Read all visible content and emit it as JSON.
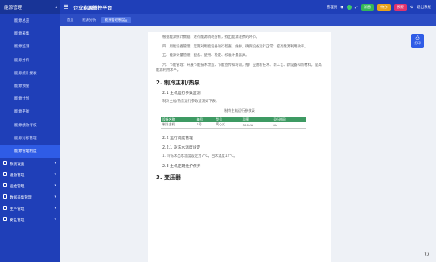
{
  "app": {
    "title": "企业能源管控平台"
  },
  "sidebar": {
    "header": "能源管理",
    "items": [
      {
        "label": "能源总览",
        "active": false
      },
      {
        "label": "能源采集",
        "active": false
      },
      {
        "label": "能源监测",
        "active": false
      },
      {
        "label": "能源分析",
        "active": false
      },
      {
        "label": "能源统计报表",
        "active": false
      },
      {
        "label": "能源预警",
        "active": false
      },
      {
        "label": "能源计划",
        "active": false
      },
      {
        "label": "能源平衡",
        "active": false
      },
      {
        "label": "能源绩效考核",
        "active": false
      },
      {
        "label": "能源对标管理",
        "active": false
      },
      {
        "label": "能源管理制度",
        "active": true
      }
    ],
    "groups": [
      {
        "label": "系统设置"
      },
      {
        "label": "设备管理"
      },
      {
        "label": "运维管理"
      },
      {
        "label": "数据采集管理"
      },
      {
        "label": "生产管理"
      },
      {
        "label": "安全管理"
      }
    ]
  },
  "topbar": {
    "user": "管理员",
    "btn1": "消息",
    "btn2": "待办",
    "btn3": "预警",
    "link": "退出系统"
  },
  "tabs": [
    {
      "label": "首页",
      "active": false
    },
    {
      "label": "能源分析",
      "active": false
    },
    {
      "label": "能源管理制度",
      "active": true
    }
  ],
  "doc": {
    "p1": "根据能源统计数据，进行能源消耗分析，找出能源浪费的环节。",
    "p2": "四、用能设备管理：定期对用能设备进行检查、维护，确保设备运行正常，提高能源利用效率。",
    "p3": "五、能源计量管理：配备、使用、检定、校准计量器具。",
    "p4": "六、节能管理：开展节能技术改造、节能宣传和培训，推广应用新技术、新工艺、新设备和新材料，提高能源利用水平。",
    "h_section2": "2. 制冷主机/热泵",
    "h_2_1": "2.1 主机运行参数监测",
    "p_2_1": "制冷主机/热泵运行参数监测如下表。",
    "table_title": "制冷主机运行参数表",
    "table_headers": [
      "设备名称",
      "编号",
      "型号",
      "功率",
      "运行时间"
    ],
    "table_rows": [
      [
        "制冷主机",
        "1号",
        "离心式",
        "500kW",
        "8h"
      ]
    ],
    "h_2_2": "2.2 运行调度管理",
    "h_2_2_1": "2.2.1 冷冻水温度设定",
    "p_2_2_1": "1. 冷冻水出水温度设定为7°C，回水温度12°C。",
    "h_2_3": "2.3 主机定期维护保养",
    "h_section3": "3. 变压器"
  },
  "float": {
    "label": "打印"
  }
}
